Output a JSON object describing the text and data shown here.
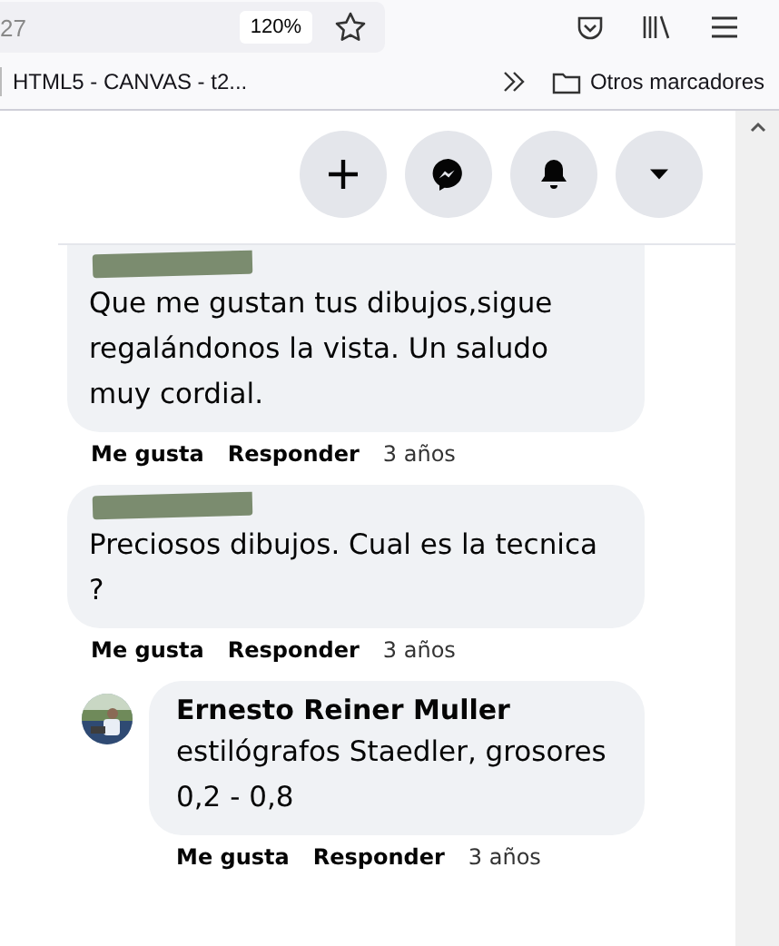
{
  "browser": {
    "address_fragment": "27",
    "zoom": "120%",
    "bookmarks": [
      {
        "label": "HTML5 - CANVAS - t2..."
      }
    ],
    "other_bookmarks": "Otros marcadores"
  },
  "header_buttons": [
    {
      "kind": "plus"
    },
    {
      "kind": "messenger"
    },
    {
      "kind": "bell"
    },
    {
      "kind": "caret"
    }
  ],
  "comments": [
    {
      "author_redacted": true,
      "text": "Que me gustan tus dibujos,sigue regalándonos la vista. Un saludo muy cordial.",
      "actions": {
        "like": "Me gusta",
        "reply": "Responder",
        "time": "3 años"
      }
    },
    {
      "author_redacted": true,
      "text": "Preciosos dibujos. Cual es la tecnica ?",
      "actions": {
        "like": "Me gusta",
        "reply": "Responder",
        "time": "3 años"
      },
      "children": [
        {
          "author": "Ernesto Reiner Muller",
          "text": "estilógrafos Staedler, grosores 0,2 - 0,8",
          "actions": {
            "like": "Me gusta",
            "reply": "Responder",
            "time": "3 años"
          }
        }
      ]
    }
  ]
}
